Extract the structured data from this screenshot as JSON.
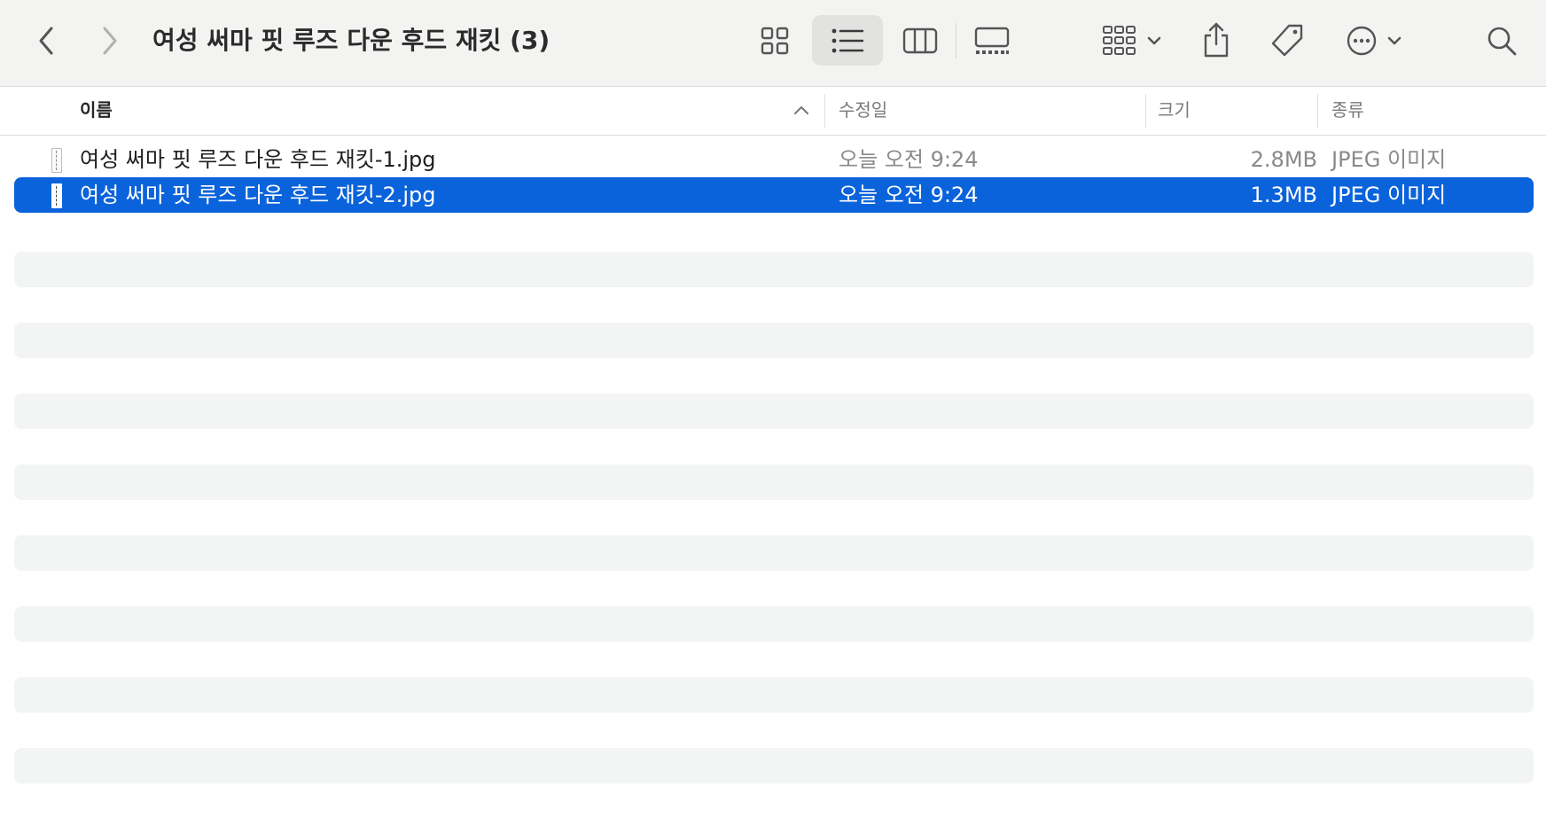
{
  "window": {
    "title": "여성 써마 핏 루즈 다운 후드 재킷 (3)"
  },
  "toolbar": {
    "back_icon": "chevron-left-icon",
    "forward_icon": "chevron-right-icon",
    "views": [
      {
        "name": "icon-view",
        "icon": "grid-icon",
        "selected": false
      },
      {
        "name": "list-view",
        "icon": "list-icon",
        "selected": true
      },
      {
        "name": "column-view",
        "icon": "columns-icon",
        "selected": false
      },
      {
        "name": "gallery-view",
        "icon": "gallery-icon",
        "selected": false
      }
    ],
    "group_icon": "group-grid-icon",
    "share_icon": "share-icon",
    "tag_icon": "tag-icon",
    "action_icon": "ellipsis-circle-icon",
    "search_icon": "search-icon"
  },
  "columns": {
    "name": "이름",
    "date": "수정일",
    "size": "크기",
    "kind": "종류",
    "sort_direction": "ascending"
  },
  "files": [
    {
      "name": "여성 써마 핏 루즈 다운 후드 재킷-1.jpg",
      "date": "오늘 오전 9:24",
      "size": "2.8MB",
      "kind": "JPEG 이미지",
      "selected": false
    },
    {
      "name": "여성 써마 핏 루즈 다운 후드 재킷-2.jpg",
      "date": "오늘 오전 9:24",
      "size": "1.3MB",
      "kind": "JPEG 이미지",
      "selected": true
    }
  ],
  "colors": {
    "selection": "#0a63db",
    "toolbar_bg": "#f3f3f2",
    "stripe_bg": "#f3f4f4",
    "secondary_text": "#8a8a8a"
  }
}
